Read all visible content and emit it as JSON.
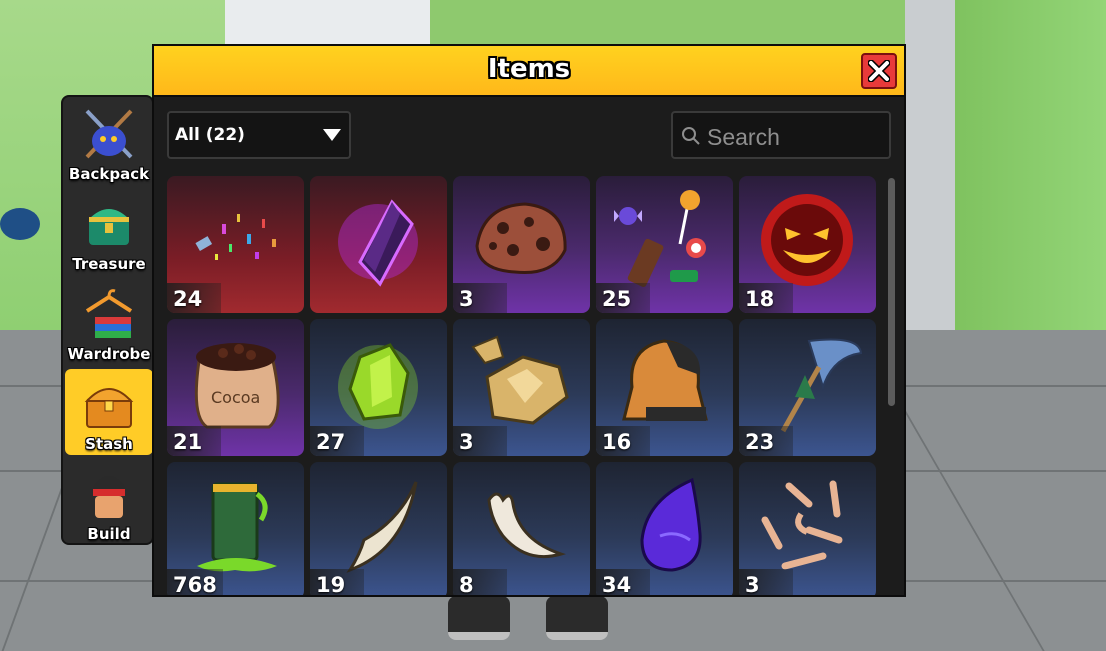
{
  "window": {
    "title": "Items"
  },
  "filter": {
    "selected": "All (22)"
  },
  "search": {
    "placeholder": "Search"
  },
  "sidebar": {
    "items": [
      {
        "label": "Backpack",
        "icon": "backpack-icon",
        "active": false
      },
      {
        "label": "Treasure",
        "icon": "treasure-icon",
        "active": false
      },
      {
        "label": "Wardrobe",
        "icon": "wardrobe-icon",
        "active": false
      },
      {
        "label": "Stash",
        "icon": "stash-icon",
        "active": true
      },
      {
        "label": "Build",
        "icon": "build-icon",
        "active": false
      }
    ]
  },
  "items": [
    {
      "icon": "confetti-icon",
      "quantity": "24",
      "rarity": "red"
    },
    {
      "icon": "dark-crystal-icon",
      "quantity": "",
      "rarity": "red"
    },
    {
      "icon": "cookie-icon",
      "quantity": "3",
      "rarity": "purple"
    },
    {
      "icon": "candy-icon",
      "quantity": "25",
      "rarity": "purple"
    },
    {
      "icon": "evil-fireball-icon",
      "quantity": "18",
      "rarity": "purple"
    },
    {
      "icon": "cocoa-sack-icon",
      "quantity": "21",
      "rarity": "purple"
    },
    {
      "icon": "green-ore-icon",
      "quantity": "27",
      "rarity": "blue"
    },
    {
      "icon": "gold-ore-icon",
      "quantity": "3",
      "rarity": "blue"
    },
    {
      "icon": "hood-cloth-icon",
      "quantity": "16",
      "rarity": "blue"
    },
    {
      "icon": "feather-arrow-icon",
      "quantity": "23",
      "rarity": "blue"
    },
    {
      "icon": "slime-jar-icon",
      "quantity": "768",
      "rarity": "blue"
    },
    {
      "icon": "fang-icon",
      "quantity": "19",
      "rarity": "blue"
    },
    {
      "icon": "tooth-icon",
      "quantity": "8",
      "rarity": "blue"
    },
    {
      "icon": "purple-drop-icon",
      "quantity": "34",
      "rarity": "blue"
    },
    {
      "icon": "bones-icon",
      "quantity": "3",
      "rarity": "blue"
    }
  ],
  "colors": {
    "titlebar": "#ffc71f",
    "active_tab": "#ffcc27",
    "close": "#e83a3a"
  }
}
